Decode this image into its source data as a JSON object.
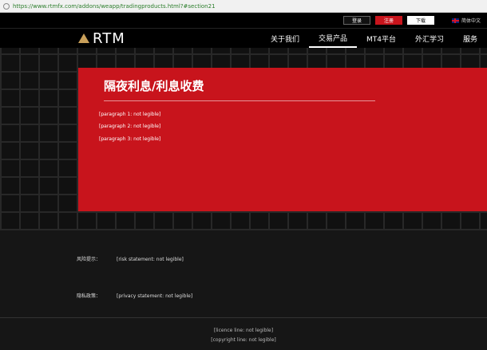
{
  "browser": {
    "url": "https://www.rtmfx.com/addons/weapp/tradingproducts.html?#section21"
  },
  "topbar": {
    "login": "登录",
    "register": "注册",
    "download": "下载",
    "language": "简体中文"
  },
  "nav": {
    "logo": "RTM",
    "items": [
      "关于我们",
      "交易产品",
      "MT4平台",
      "外汇学习",
      "服务"
    ]
  },
  "hero": {
    "title": "隔夜利息/利息收费",
    "paragraphs": [
      "[paragraph 1: not legible]",
      "[paragraph 2: not legible]",
      "[paragraph 3: not legible]"
    ]
  },
  "footer": {
    "risk_label": "风险提示：",
    "risk_text": "[risk statement: not legible]",
    "privacy_label": "隐私政策：",
    "privacy_text": "[privacy statement: not legible]",
    "license": "[licence line: not legible]",
    "copyright": "[copyright line: not legible]"
  },
  "colors": {
    "brand_red": "#c8141c",
    "gold": "#c9a05a"
  }
}
